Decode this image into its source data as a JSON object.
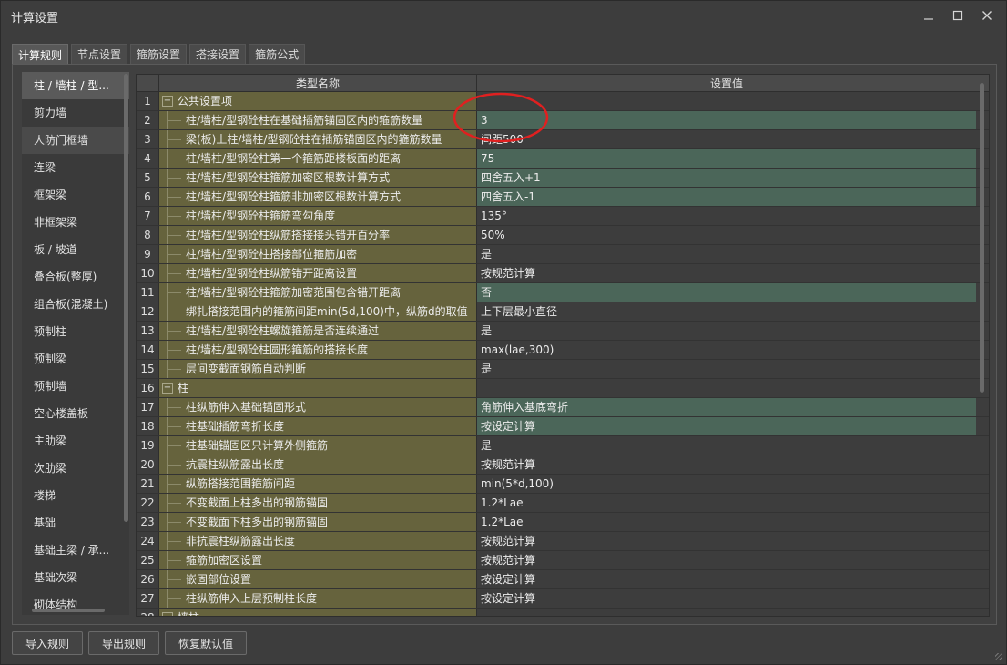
{
  "window": {
    "title": "计算设置"
  },
  "tabs": [
    {
      "label": "计算规则",
      "active": true
    },
    {
      "label": "节点设置",
      "active": false
    },
    {
      "label": "箍筋设置",
      "active": false
    },
    {
      "label": "搭接设置",
      "active": false
    },
    {
      "label": "箍筋公式",
      "active": false
    }
  ],
  "sidebar": {
    "items": [
      {
        "label": "柱 / 墙柱 / 型...",
        "state": "selected"
      },
      {
        "label": "剪力墙",
        "state": ""
      },
      {
        "label": "人防门框墙",
        "state": "hover"
      },
      {
        "label": "连梁",
        "state": ""
      },
      {
        "label": "框架梁",
        "state": ""
      },
      {
        "label": "非框架梁",
        "state": ""
      },
      {
        "label": "板 / 坡道",
        "state": ""
      },
      {
        "label": "叠合板(整厚)",
        "state": ""
      },
      {
        "label": "组合板(混凝土)",
        "state": ""
      },
      {
        "label": "预制柱",
        "state": ""
      },
      {
        "label": "预制梁",
        "state": ""
      },
      {
        "label": "预制墙",
        "state": ""
      },
      {
        "label": "空心楼盖板",
        "state": ""
      },
      {
        "label": "主肋梁",
        "state": ""
      },
      {
        "label": "次肋梁",
        "state": ""
      },
      {
        "label": "楼梯",
        "state": ""
      },
      {
        "label": "基础",
        "state": ""
      },
      {
        "label": "基础主梁 / 承...",
        "state": ""
      },
      {
        "label": "基础次梁",
        "state": ""
      },
      {
        "label": "砌体结构",
        "state": ""
      }
    ]
  },
  "grid": {
    "headers": {
      "name": "类型名称",
      "value": "设置值"
    },
    "rows": [
      {
        "num": "1",
        "kind": "group",
        "name": "公共设置项",
        "value": "",
        "green": false
      },
      {
        "num": "2",
        "kind": "child",
        "name": "柱/墙柱/型钢砼柱在基础插筋锚固区内的箍筋数量",
        "value": "3",
        "green": true
      },
      {
        "num": "3",
        "kind": "child",
        "name": "梁(板)上柱/墙柱/型钢砼柱在插筋锚固区内的箍筋数量",
        "value": "间距500",
        "green": false
      },
      {
        "num": "4",
        "kind": "child",
        "name": "柱/墙柱/型钢砼柱第一个箍筋距楼板面的距离",
        "value": "75",
        "green": true
      },
      {
        "num": "5",
        "kind": "child",
        "name": "柱/墙柱/型钢砼柱箍筋加密区根数计算方式",
        "value": "四舍五入+1",
        "green": true
      },
      {
        "num": "6",
        "kind": "child",
        "name": "柱/墙柱/型钢砼柱箍筋非加密区根数计算方式",
        "value": "四舍五入-1",
        "green": true
      },
      {
        "num": "7",
        "kind": "child",
        "name": "柱/墙柱/型钢砼柱箍筋弯勾角度",
        "value": "135°",
        "green": false
      },
      {
        "num": "8",
        "kind": "child",
        "name": "柱/墙柱/型钢砼柱纵筋搭接接头错开百分率",
        "value": "50%",
        "green": false
      },
      {
        "num": "9",
        "kind": "child",
        "name": "柱/墙柱/型钢砼柱搭接部位箍筋加密",
        "value": "是",
        "green": false
      },
      {
        "num": "10",
        "kind": "child",
        "name": "柱/墙柱/型钢砼柱纵筋错开距离设置",
        "value": "按规范计算",
        "green": false
      },
      {
        "num": "11",
        "kind": "child",
        "name": "柱/墙柱/型钢砼柱箍筋加密范围包含错开距离",
        "value": "否",
        "green": true
      },
      {
        "num": "12",
        "kind": "child",
        "name": "绑扎搭接范围内的箍筋间距min(5d,100)中，纵筋d的取值",
        "value": "上下层最小直径",
        "green": false
      },
      {
        "num": "13",
        "kind": "child",
        "name": "柱/墙柱/型钢砼柱螺旋箍筋是否连续通过",
        "value": "是",
        "green": false
      },
      {
        "num": "14",
        "kind": "child",
        "name": "柱/墙柱/型钢砼柱圆形箍筋的搭接长度",
        "value": "max(lae,300)",
        "green": false
      },
      {
        "num": "15",
        "kind": "child",
        "name": "层间变截面钢筋自动判断",
        "value": "是",
        "green": false
      },
      {
        "num": "16",
        "kind": "group",
        "name": "柱",
        "value": "",
        "green": false
      },
      {
        "num": "17",
        "kind": "child",
        "name": "柱纵筋伸入基础锚固形式",
        "value": "角筋伸入基底弯折",
        "green": true
      },
      {
        "num": "18",
        "kind": "child",
        "name": "柱基础插筋弯折长度",
        "value": "按设定计算",
        "green": true
      },
      {
        "num": "19",
        "kind": "child",
        "name": "柱基础锚固区只计算外侧箍筋",
        "value": "是",
        "green": false
      },
      {
        "num": "20",
        "kind": "child",
        "name": "抗震柱纵筋露出长度",
        "value": "按规范计算",
        "green": false
      },
      {
        "num": "21",
        "kind": "child",
        "name": "纵筋搭接范围箍筋间距",
        "value": "min(5*d,100)",
        "green": false
      },
      {
        "num": "22",
        "kind": "child",
        "name": "不变截面上柱多出的钢筋锚固",
        "value": "1.2*Lae",
        "green": false
      },
      {
        "num": "23",
        "kind": "child",
        "name": "不变截面下柱多出的钢筋锚固",
        "value": "1.2*Lae",
        "green": false
      },
      {
        "num": "24",
        "kind": "child",
        "name": "非抗震柱纵筋露出长度",
        "value": "按规范计算",
        "green": false
      },
      {
        "num": "25",
        "kind": "child",
        "name": "箍筋加密区设置",
        "value": "按规范计算",
        "green": false
      },
      {
        "num": "26",
        "kind": "child",
        "name": "嵌固部位设置",
        "value": "按设定计算",
        "green": false
      },
      {
        "num": "27",
        "kind": "child",
        "name": "柱纵筋伸入上层预制柱长度",
        "value": "按设定计算",
        "green": false
      },
      {
        "num": "28",
        "kind": "group",
        "name": "墙柱",
        "value": "",
        "green": false
      }
    ]
  },
  "buttons": {
    "import": "导入规则",
    "export": "导出规则",
    "reset": "恢复默认值"
  },
  "icons": {
    "minimize": "minimize-icon",
    "maximize": "maximize-icon",
    "close": "close-icon",
    "collapse": "collapse-minus-icon"
  },
  "colors": {
    "name_column": "#66633d",
    "value_highlight": "#4b6659",
    "annotation_ellipse": "#e02020"
  }
}
